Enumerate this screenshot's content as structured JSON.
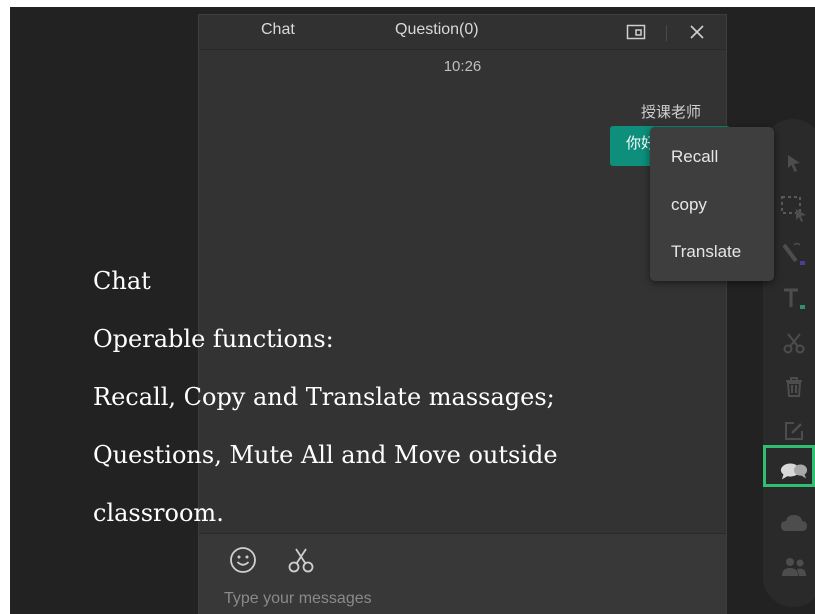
{
  "chat_window": {
    "tabs": [
      {
        "label": "Chat"
      },
      {
        "label": "Question(0)"
      }
    ],
    "timestamp": "10:26",
    "message": {
      "sender": "授课老师",
      "text": "你好"
    },
    "footer": {
      "input_placeholder": "Type your messages"
    }
  },
  "context_menu": {
    "items": [
      "Recall",
      "copy",
      "Translate"
    ]
  },
  "toolbar": {
    "icons": [
      "cursor-icon",
      "select-area-icon",
      "pen-icon",
      "text-icon",
      "scissors-icon",
      "trash-icon",
      "edit-icon",
      "chat-icon",
      "cloud-icon",
      "users-icon"
    ],
    "active": "chat-icon",
    "highlight_color": "#2fbf71"
  },
  "caption": {
    "lines": [
      "Chat",
      "Operable functions:",
      "Recall, Copy and Translate massages;",
      "Questions, Mute All and Move outside",
      "classroom."
    ]
  },
  "colors": {
    "background": "#222222",
    "panel": "#333333",
    "bubble": "#0d8f7b"
  }
}
